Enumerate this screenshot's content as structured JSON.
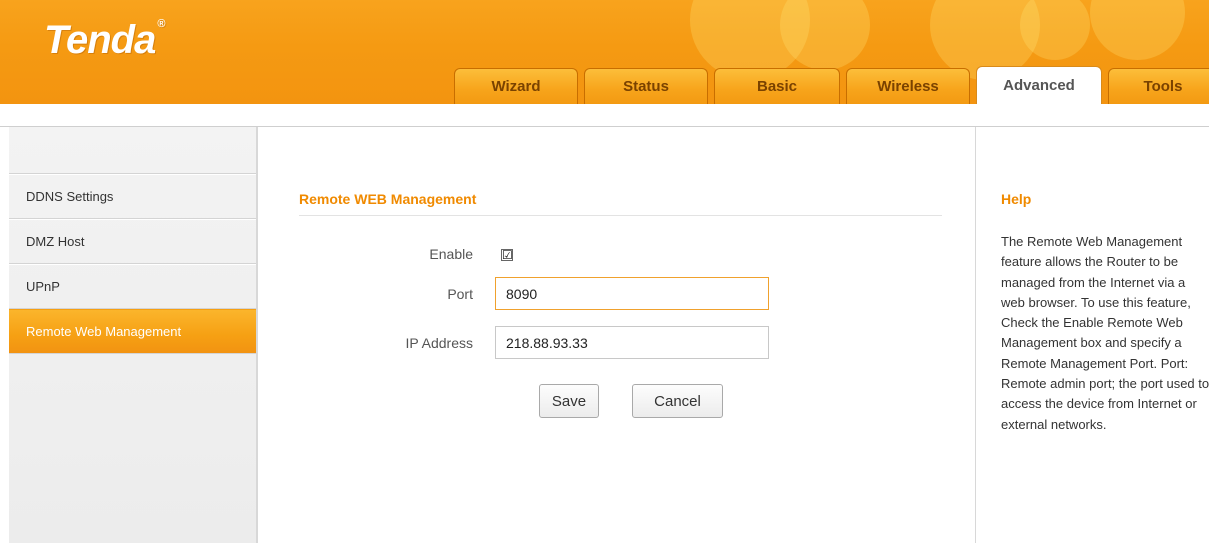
{
  "brand": {
    "logo_text": "Tenda",
    "logo_mark": "®"
  },
  "nav": {
    "tabs": [
      {
        "label": "Wizard",
        "active": false
      },
      {
        "label": "Status",
        "active": false
      },
      {
        "label": "Basic",
        "active": false
      },
      {
        "label": "Wireless",
        "active": false
      },
      {
        "label": "Advanced",
        "active": true
      },
      {
        "label": "Tools",
        "active": false
      }
    ]
  },
  "sidebar": {
    "items": [
      {
        "label": "DDNS Settings",
        "active": false
      },
      {
        "label": "DMZ Host",
        "active": false
      },
      {
        "label": "UPnP",
        "active": false
      },
      {
        "label": "Remote Web Management",
        "active": true
      }
    ]
  },
  "main": {
    "section_title": "Remote WEB Management",
    "enable": {
      "label": "Enable",
      "checked": true,
      "check_glyph": "☑"
    },
    "port": {
      "label": "Port",
      "value": "8090"
    },
    "ip": {
      "label": "IP Address",
      "value": "218.88.93.33"
    },
    "save_label": "Save",
    "cancel_label": "Cancel"
  },
  "help": {
    "title": "Help",
    "body": "The Remote Web Management feature allows the Router to be managed from the Internet via a web browser. To use this feature, Check the Enable Remote Web Management box and specify a Remote Management Port. Port: Remote admin port; the port used to access the device from Internet or external networks."
  },
  "colors": {
    "accent_orange": "#f39a12",
    "title_orange": "#f08a00",
    "focus_border": "#f0a12d"
  }
}
